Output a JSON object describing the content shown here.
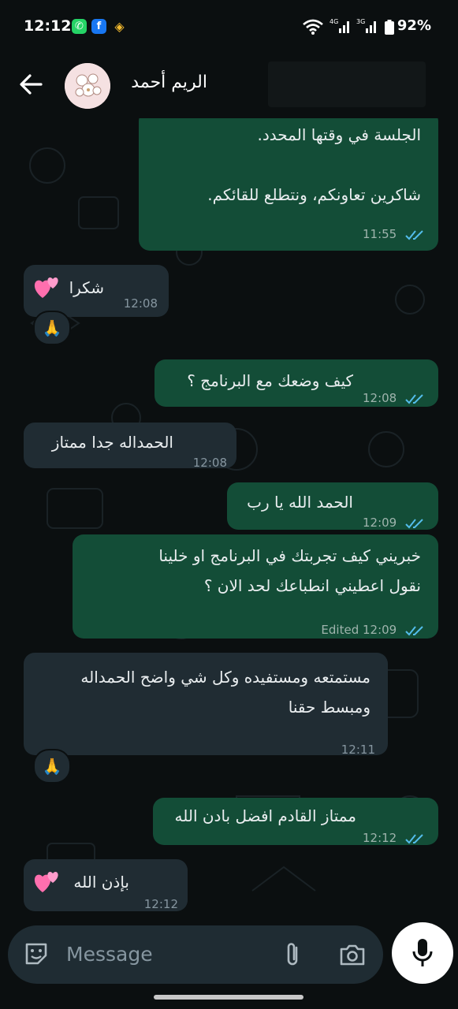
{
  "status_bar": {
    "time": "12:12",
    "right_text": "92%",
    "icons": [
      "whatsapp-icon",
      "facebook-icon",
      "binance-icon",
      "wifi-icon",
      "signal-4g-icon",
      "signal-3g-icon",
      "battery-icon"
    ]
  },
  "header": {
    "contact_name": "الريم أحمد",
    "back_icon": "arrow-left-icon"
  },
  "messages": [
    {
      "direction": "out",
      "text": "الجلسة في وقتها المحدد.\n\nشاكرين تعاونكم، ونتطلع للقائكم.",
      "time": "11:55",
      "status": "read"
    },
    {
      "direction": "in",
      "text": "شكرا",
      "emoji": "💞",
      "time": "12:08",
      "reaction": "🙏"
    },
    {
      "direction": "out",
      "text": "كيف وضعك مع البرنامج ؟",
      "time": "12:08",
      "status": "read"
    },
    {
      "direction": "in",
      "text": "الحمداله جدا ممتاز",
      "time": "12:08"
    },
    {
      "direction": "out",
      "text": "الحمد الله يا رب",
      "time": "12:09",
      "status": "read"
    },
    {
      "direction": "out",
      "text": "خبريني كيف تجربتك في البرنامج او خلينا\nنقول اعطيني انطباعك لحد الان ؟",
      "time": "Edited 12:09",
      "status": "read"
    },
    {
      "direction": "in",
      "text": "مستمتعه ومستفيده وكل شي واضح الحمداله\nومبسط حقنا",
      "time": "12:11",
      "reaction": "🙏"
    },
    {
      "direction": "out",
      "text": "ممتاز القادم افضل بادن الله",
      "time": "12:12",
      "status": "read"
    },
    {
      "direction": "in",
      "text": "بإذن الله",
      "emoji": "💞",
      "time": "12:12"
    }
  ],
  "composer": {
    "placeholder": "Message",
    "icons": [
      "emoji-icon",
      "attach-icon",
      "camera-icon",
      "microphone-icon"
    ]
  },
  "colors": {
    "outgoing_bubble": "#134d37",
    "incoming_bubble": "#202c33",
    "read_ticks": "#53bdeb",
    "background": "#0b0f10"
  }
}
